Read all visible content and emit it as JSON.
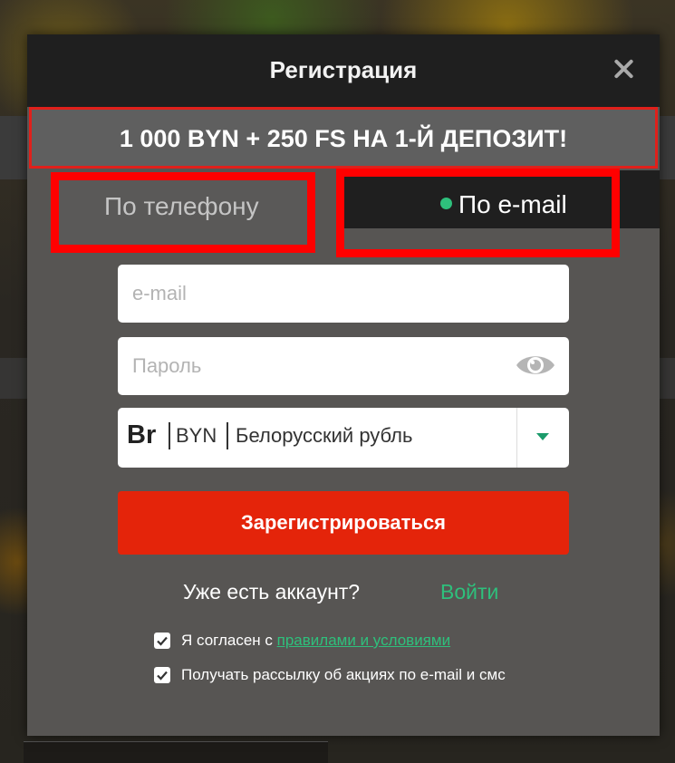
{
  "modal": {
    "title": "Регистрация",
    "bonus_banner": "1 000 BYN + 250 FS НА 1-Й ДЕПОЗИТ!"
  },
  "tabs": {
    "phone_label": "По телефону",
    "email_label": "По e-mail",
    "active": "email"
  },
  "form": {
    "email_placeholder": "e-mail",
    "password_placeholder": "Пароль",
    "currency": {
      "symbol": "Br",
      "code": "BYN",
      "name": "Белорусский рубль"
    },
    "register_label": "Зарегистрироваться"
  },
  "login": {
    "question": "Уже есть аккаунт?",
    "link_label": "Войти"
  },
  "consents": {
    "agree_prefix": "Я согласен с ",
    "agree_link": "правилами и условиями",
    "agree_checked": true,
    "newsletter_text": "Получать рассылку об акциях по e-mail и смс",
    "newsletter_checked": true
  },
  "colors": {
    "accent_green": "#2ec07c",
    "register_red": "#e4240a",
    "highlight_red": "#ff0000"
  }
}
